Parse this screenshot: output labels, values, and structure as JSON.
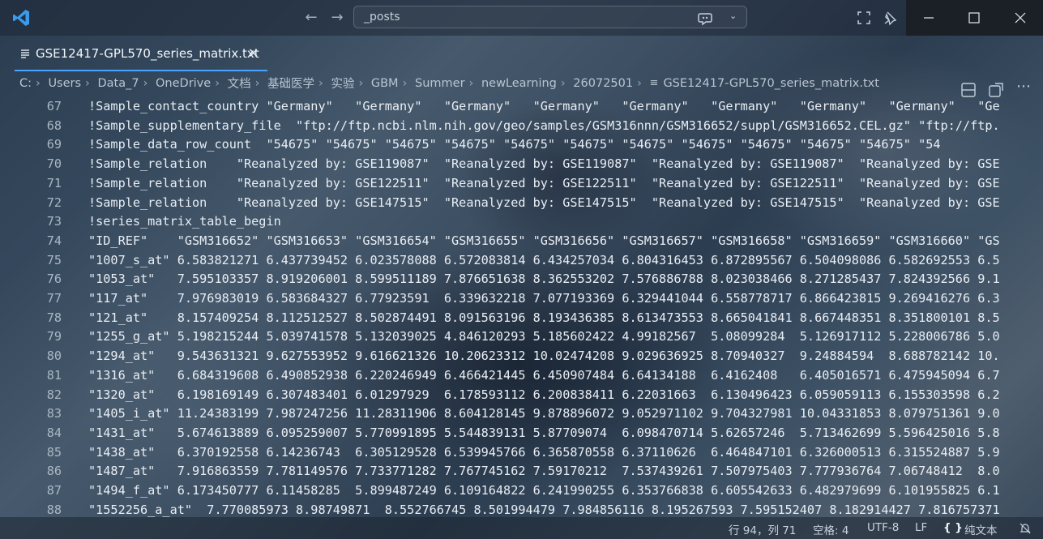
{
  "titlebar": {
    "search_text": "_posts",
    "icons": [
      "vscode-logo-icon",
      "back-arrow-icon",
      "forward-arrow-icon",
      "copilot-icon",
      "chevron-down-icon",
      "focus-icon",
      "pin-icon",
      "minimize-icon",
      "maximize-icon",
      "close-icon"
    ]
  },
  "tab": {
    "filename": "GSE12417-GPL570_series_matrix.txt",
    "close_glyph": "✕"
  },
  "breadcrumb": [
    "C:",
    "Users",
    "Data_7",
    "OneDrive",
    "文档",
    "基础医学",
    "实验",
    "GBM",
    "Summer",
    "newLearning",
    "26072501",
    "GSE12417-GPL570_series_matrix.txt"
  ],
  "editor": {
    "lines": [
      {
        "num": "67",
        "text": "!Sample_contact_country \"Germany\"   \"Germany\"   \"Germany\"   \"Germany\"   \"Germany\"   \"Germany\"   \"Germany\"   \"Germany\"   \"Ge"
      },
      {
        "num": "68",
        "text": "!Sample_supplementary_file  \"ftp://ftp.ncbi.nlm.nih.gov/geo/samples/GSM316nnn/GSM316652/suppl/GSM316652.CEL.gz\" \"ftp://ftp."
      },
      {
        "num": "69",
        "text": "!Sample_data_row_count  \"54675\" \"54675\" \"54675\" \"54675\" \"54675\" \"54675\" \"54675\" \"54675\" \"54675\" \"54675\" \"54675\" \"54"
      },
      {
        "num": "70",
        "text": "!Sample_relation    \"Reanalyzed by: GSE119087\"  \"Reanalyzed by: GSE119087\"  \"Reanalyzed by: GSE119087\"  \"Reanalyzed by: GSE"
      },
      {
        "num": "71",
        "text": "!Sample_relation    \"Reanalyzed by: GSE122511\"  \"Reanalyzed by: GSE122511\"  \"Reanalyzed by: GSE122511\"  \"Reanalyzed by: GSE"
      },
      {
        "num": "72",
        "text": "!Sample_relation    \"Reanalyzed by: GSE147515\"  \"Reanalyzed by: GSE147515\"  \"Reanalyzed by: GSE147515\"  \"Reanalyzed by: GSE"
      },
      {
        "num": "73",
        "text": "!series_matrix_table_begin"
      },
      {
        "num": "74",
        "text": "\"ID_REF\"    \"GSM316652\" \"GSM316653\" \"GSM316654\" \"GSM316655\" \"GSM316656\" \"GSM316657\" \"GSM316658\" \"GSM316659\" \"GSM316660\" \"GS"
      },
      {
        "num": "75",
        "text": "\"1007_s_at\" 6.583821271 6.437739452 6.023578088 6.572083814 6.434257034 6.804316453 6.872895567 6.504098086 6.582692553 6.5"
      },
      {
        "num": "76",
        "text": "\"1053_at\"   7.595103357 8.919206001 8.599511189 7.876651638 8.362553202 7.576886788 8.023038466 8.271285437 7.824392566 9.1"
      },
      {
        "num": "77",
        "text": "\"117_at\"    7.976983019 6.583684327 6.77923591  6.339632218 7.077193369 6.329441044 6.558778717 6.866423815 9.269416276 6.3"
      },
      {
        "num": "78",
        "text": "\"121_at\"    8.157409254 8.112512527 8.502874491 8.091563196 8.193436385 8.613473553 8.665041841 8.667448351 8.351800101 8.5"
      },
      {
        "num": "79",
        "text": "\"1255_g_at\" 5.198215244 5.039741578 5.132039025 4.846120293 5.185602422 4.99182567  5.08099284  5.126917112 5.228006786 5.0"
      },
      {
        "num": "80",
        "text": "\"1294_at\"   9.543631321 9.627553952 9.616621326 10.20623312 10.02474208 9.029636925 8.70940327  9.24884594  8.688782142 10."
      },
      {
        "num": "81",
        "text": "\"1316_at\"   6.684319608 6.490852938 6.220246949 6.466421445 6.450907484 6.64134188  6.4162408   6.405016571 6.475945094 6.7"
      },
      {
        "num": "82",
        "text": "\"1320_at\"   6.198169149 6.307483401 6.01297929  6.178593112 6.200838411 6.22031663  6.130496423 6.059059113 6.155303598 6.2"
      },
      {
        "num": "83",
        "text": "\"1405_i_at\" 11.24383199 7.987247256 11.28311906 8.604128145 9.878896072 9.052971102 9.704327981 10.04331853 8.079751361 9.0"
      },
      {
        "num": "84",
        "text": "\"1431_at\"   5.674613889 6.095259007 5.770991895 5.544839131 5.87709074  6.098470714 5.62657246  5.713462699 5.596425016 5.8"
      },
      {
        "num": "85",
        "text": "\"1438_at\"   6.370192558 6.14236743  6.305129528 6.539945766 6.365870558 6.37110626  6.464847101 6.326000513 6.315524887 5.9"
      },
      {
        "num": "86",
        "text": "\"1487_at\"   7.916863559 7.781149576 7.733771282 7.767745162 7.59170212  7.537439261 7.507975403 7.777936764 7.06748412  8.0"
      },
      {
        "num": "87",
        "text": "\"1494_f_at\" 6.173450777 6.11458285  5.899487249 6.109164822 6.241990255 6.353766838 6.605542633 6.482979699 6.101955825 6.1"
      },
      {
        "num": "88",
        "text": "\"1552256_a_at\"  7.770085973 8.98749871  8.552766745 8.501994479 7.984856116 8.195267593 7.595152407 8.182914427 7.816757371"
      }
    ]
  },
  "statusbar": {
    "position": "行 94，列 71",
    "indent": "空格: 4",
    "encoding": "UTF-8",
    "eol": "LF",
    "language_icon": "{ }",
    "language": "纯文本",
    "notifications_icon": "bell-slash-icon"
  },
  "colors": {
    "accent": "#4aa3ff",
    "vscode_blue": "#3b9bea",
    "window_controls_bg": "#1b1f26"
  }
}
